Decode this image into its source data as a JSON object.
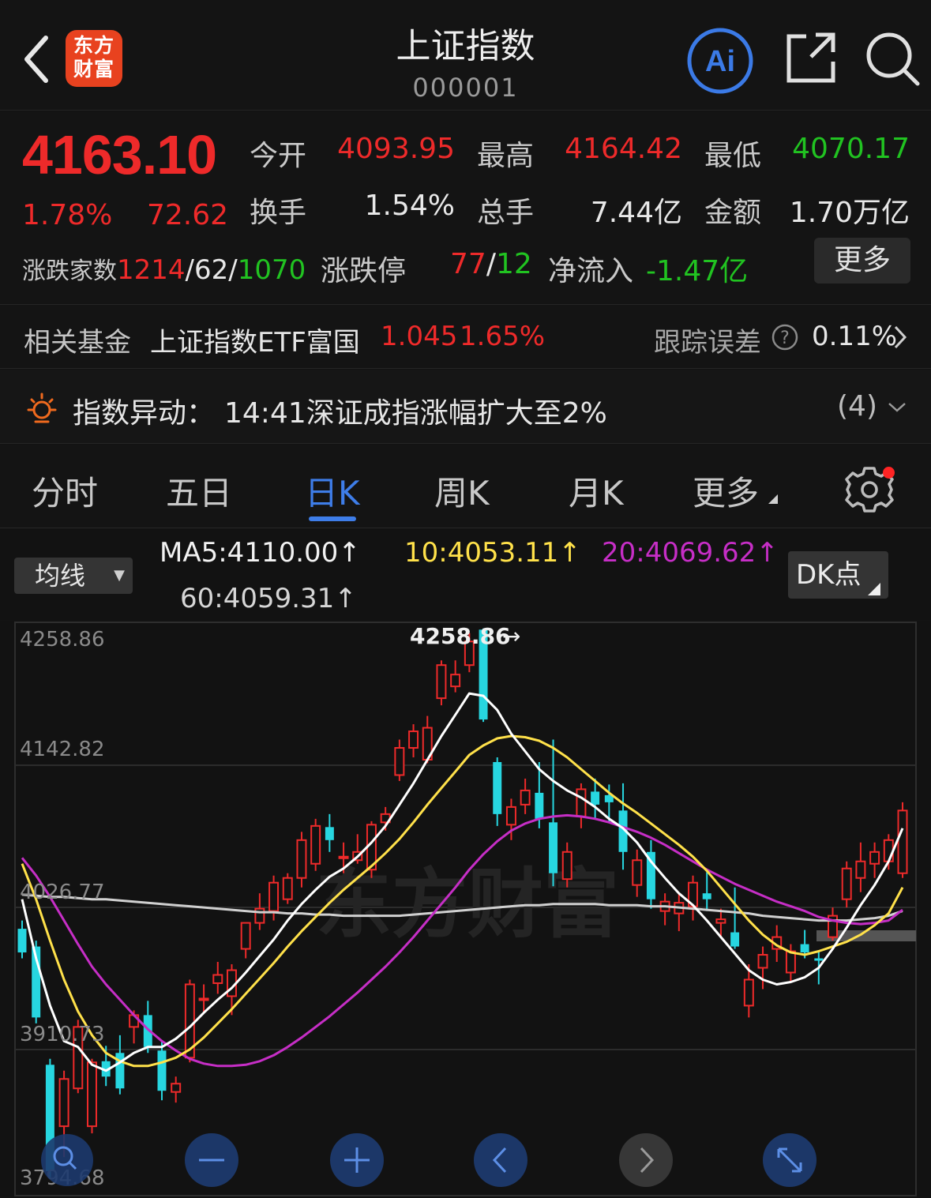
{
  "header": {
    "logo_text": "东方财富",
    "title": "上证指数",
    "code": "000001",
    "ai_label": "Ai",
    "icons": [
      "back-icon",
      "ai-icon",
      "share-icon",
      "search-icon"
    ]
  },
  "quote": {
    "price": "4163.10",
    "change_pct": "1.78%",
    "change": "72.62",
    "stats": [
      {
        "label": "今开",
        "value": "4093.95",
        "color": "red"
      },
      {
        "label": "最高",
        "value": "4164.42",
        "color": "red"
      },
      {
        "label": "最低",
        "value": "4070.17",
        "color": "green"
      },
      {
        "label": "换手",
        "value": "1.54%",
        "color": "white"
      },
      {
        "label": "总手",
        "value": "7.44亿",
        "color": "white"
      },
      {
        "label": "金额",
        "value": "1.70万亿",
        "color": "white"
      }
    ],
    "breadth_label": "涨跌家数",
    "breadth_up": "1214",
    "breadth_flat": "62",
    "breadth_down": "1070",
    "limit_label": "涨跌停",
    "limit_up": "77",
    "limit_down": "12",
    "netflow_label": "净流入",
    "netflow": "-1.47亿",
    "more_label": "更多",
    "slash": "/"
  },
  "fund": {
    "label": "相关基金",
    "name": "上证指数ETF富国",
    "price": "1.045",
    "pct": "1.65%",
    "error_label": "跟踪误差",
    "error_value": "0.11%"
  },
  "alert": {
    "label": "指数异动：",
    "text": "14:41深证成指涨幅扩大至2%",
    "count": "(4)"
  },
  "tabs": [
    "分时",
    "五日",
    "日K",
    "周K",
    "月K",
    "更多"
  ],
  "active_tab": 2,
  "ma": {
    "selector": "均线",
    "ma5": "MA5:4110.00↑",
    "ma10": "10:4053.11↑",
    "ma20": "20:4069.62↑",
    "ma60": "60:4059.31↑",
    "dk": "DK点",
    "colors": {
      "ma5": "#ffffff",
      "ma10": "#ffe14a",
      "ma20": "#c62ec6",
      "ma60": "#d0d0d0"
    }
  },
  "chart_data": {
    "type": "candlestick",
    "y_ticks": [
      "4258.86",
      "4142.82",
      "4026.77",
      "3910.73",
      "3794.68"
    ],
    "ylim": [
      3794.68,
      4258.86
    ],
    "max_annotation": "4258.86",
    "watermark": "东方财富",
    "colors": {
      "up": "#ee2a2a",
      "down": "#27d6e0",
      "grid": "#2c2c2c"
    },
    "candles": [
      {
        "o": 4005,
        "h": 4012,
        "l": 3980,
        "c": 3985
      },
      {
        "o": 3990,
        "h": 3995,
        "l": 3925,
        "c": 3930
      },
      {
        "o": 3890,
        "h": 3895,
        "l": 3795,
        "c": 3800
      },
      {
        "o": 3838,
        "h": 3885,
        "l": 3812,
        "c": 3878
      },
      {
        "o": 3870,
        "h": 3928,
        "l": 3866,
        "c": 3922
      },
      {
        "o": 3838,
        "h": 3895,
        "l": 3832,
        "c": 3892
      },
      {
        "o": 3893,
        "h": 3906,
        "l": 3872,
        "c": 3880
      },
      {
        "o": 3900,
        "h": 3915,
        "l": 3865,
        "c": 3870
      },
      {
        "o": 3922,
        "h": 3936,
        "l": 3908,
        "c": 3932
      },
      {
        "o": 3932,
        "h": 3944,
        "l": 3900,
        "c": 3905
      },
      {
        "o": 3902,
        "h": 3910,
        "l": 3860,
        "c": 3868
      },
      {
        "o": 3867,
        "h": 3880,
        "l": 3858,
        "c": 3874
      },
      {
        "o": 3896,
        "h": 3962,
        "l": 3892,
        "c": 3958
      },
      {
        "o": 3946,
        "h": 3958,
        "l": 3934,
        "c": 3946
      },
      {
        "o": 3959,
        "h": 3977,
        "l": 3950,
        "c": 3966
      },
      {
        "o": 3948,
        "h": 3975,
        "l": 3932,
        "c": 3970
      },
      {
        "o": 3988,
        "h": 4004,
        "l": 3980,
        "c": 4010
      },
      {
        "o": 4010,
        "h": 4035,
        "l": 4004,
        "c": 4022
      },
      {
        "o": 4020,
        "h": 4050,
        "l": 4012,
        "c": 4044
      },
      {
        "o": 4030,
        "h": 4052,
        "l": 4026,
        "c": 4048
      },
      {
        "o": 4048,
        "h": 4087,
        "l": 4040,
        "c": 4080
      },
      {
        "o": 4060,
        "h": 4098,
        "l": 4054,
        "c": 4092
      },
      {
        "o": 4091,
        "h": 4102,
        "l": 4070,
        "c": 4080
      },
      {
        "o": 4065,
        "h": 4078,
        "l": 4052,
        "c": 4066
      },
      {
        "o": 4063,
        "h": 4085,
        "l": 4060,
        "c": 4070
      },
      {
        "o": 4055,
        "h": 4096,
        "l": 4048,
        "c": 4093
      },
      {
        "o": 4095,
        "h": 4108,
        "l": 4088,
        "c": 4102
      },
      {
        "o": 4135,
        "h": 4165,
        "l": 4130,
        "c": 4158
      },
      {
        "o": 4158,
        "h": 4178,
        "l": 4150,
        "c": 4172
      },
      {
        "o": 4148,
        "h": 4185,
        "l": 4145,
        "c": 4175
      },
      {
        "o": 4200,
        "h": 4232,
        "l": 4194,
        "c": 4228
      },
      {
        "o": 4210,
        "h": 4232,
        "l": 4205,
        "c": 4220
      },
      {
        "o": 4228,
        "h": 4255,
        "l": 4222,
        "c": 4248
      },
      {
        "o": 4258,
        "h": 4259,
        "l": 4180,
        "c": 4182
      },
      {
        "o": 4146,
        "h": 4150,
        "l": 4092,
        "c": 4102
      },
      {
        "o": 4093,
        "h": 4115,
        "l": 4080,
        "c": 4108
      },
      {
        "o": 4110,
        "h": 4132,
        "l": 4102,
        "c": 4122
      },
      {
        "o": 4120,
        "h": 4146,
        "l": 4090,
        "c": 4098
      },
      {
        "o": 4095,
        "h": 4165,
        "l": 4041,
        "c": 4052
      },
      {
        "o": 4047,
        "h": 4078,
        "l": 4040,
        "c": 4070
      },
      {
        "o": 4100,
        "h": 4128,
        "l": 4090,
        "c": 4123
      },
      {
        "o": 4121,
        "h": 4132,
        "l": 4098,
        "c": 4110
      },
      {
        "o": 4118,
        "h": 4127,
        "l": 4095,
        "c": 4112
      },
      {
        "o": 4105,
        "h": 4128,
        "l": 4055,
        "c": 4070
      },
      {
        "o": 4042,
        "h": 4072,
        "l": 4032,
        "c": 4063
      },
      {
        "o": 4070,
        "h": 4080,
        "l": 4022,
        "c": 4030
      },
      {
        "o": 4020,
        "h": 4035,
        "l": 4008,
        "c": 4028
      },
      {
        "o": 4018,
        "h": 4035,
        "l": 4003,
        "c": 4027
      },
      {
        "o": 4024,
        "h": 4050,
        "l": 4012,
        "c": 4044
      },
      {
        "o": 4035,
        "h": 4053,
        "l": 4020,
        "c": 4030
      },
      {
        "o": 4010,
        "h": 4022,
        "l": 3998,
        "c": 4013
      },
      {
        "o": 4002,
        "h": 4040,
        "l": 3988,
        "c": 3990
      },
      {
        "o": 3940,
        "h": 3975,
        "l": 3930,
        "c": 3962
      },
      {
        "o": 3972,
        "h": 3990,
        "l": 3954,
        "c": 3983
      },
      {
        "o": 3988,
        "h": 4008,
        "l": 3977,
        "c": 3998
      },
      {
        "o": 3968,
        "h": 3992,
        "l": 3960,
        "c": 3986
      },
      {
        "o": 3992,
        "h": 4004,
        "l": 3980,
        "c": 3985
      },
      {
        "o": 3980,
        "h": 3986,
        "l": 3958,
        "c": 3978
      },
      {
        "o": 3998,
        "h": 4023,
        "l": 3995,
        "c": 4016
      },
      {
        "o": 4030,
        "h": 4062,
        "l": 4023,
        "c": 4056
      },
      {
        "o": 4048,
        "h": 4078,
        "l": 4036,
        "c": 4062
      },
      {
        "o": 4060,
        "h": 4078,
        "l": 4048,
        "c": 4070
      },
      {
        "o": 4062,
        "h": 4085,
        "l": 4055,
        "c": 4080
      },
      {
        "o": 4052,
        "h": 4112,
        "l": 4048,
        "c": 4105
      }
    ],
    "ma5": [
      4030,
      3980,
      3940,
      3910,
      3905,
      3890,
      3885,
      3892,
      3900,
      3905,
      3905,
      3912,
      3922,
      3934,
      3945,
      3955,
      3968,
      3982,
      3996,
      4012,
      4026,
      4038,
      4049,
      4056,
      4066,
      4078,
      4092,
      4110,
      4128,
      4148,
      4168,
      4186,
      4204,
      4202,
      4190,
      4170,
      4155,
      4140,
      4130,
      4122,
      4116,
      4108,
      4098,
      4090,
      4078,
      4062,
      4048,
      4035,
      4025,
      4012,
      3998,
      3984,
      3970,
      3962,
      3958,
      3960,
      3964,
      3972,
      3988,
      4006,
      4025,
      4042,
      4062,
      4090
    ],
    "ma10": [
      4060,
      4030,
      3995,
      3962,
      3935,
      3915,
      3900,
      3893,
      3889,
      3889,
      3892,
      3896,
      3903,
      3913,
      3925,
      3937,
      3950,
      3963,
      3976,
      3990,
      4003,
      4015,
      4027,
      4038,
      4048,
      4058,
      4069,
      4081,
      4095,
      4110,
      4124,
      4138,
      4152,
      4160,
      4166,
      4168,
      4167,
      4164,
      4158,
      4150,
      4140,
      4130,
      4120,
      4111,
      4103,
      4094,
      4085,
      4076,
      4066,
      4054,
      4040,
      4026,
      4012,
      4000,
      3991,
      3985,
      3983,
      3986,
      3990,
      3994,
      4000,
      4008,
      4018,
      4040
    ],
    "ma20": [
      4065,
      4050,
      4032,
      4012,
      3992,
      3973,
      3958,
      3945,
      3932,
      3920,
      3910,
      3902,
      3895,
      3891,
      3889,
      3889,
      3890,
      3893,
      3898,
      3905,
      3913,
      3922,
      3931,
      3941,
      3951,
      3962,
      3973,
      3985,
      3998,
      4012,
      4026,
      4040,
      4055,
      4068,
      4079,
      4088,
      4094,
      4098,
      4100,
      4101,
      4100,
      4098,
      4095,
      4091,
      4087,
      4082,
      4076,
      4069,
      4062,
      4055,
      4049,
      4043,
      4038,
      4033,
      4028,
      4024,
      4020,
      4015,
      4012,
      4010,
      4009,
      4010,
      4012,
      4021
    ],
    "ma60": [
      4034,
      4033,
      4032,
      4032,
      4031,
      4030,
      4030,
      4029,
      4028,
      4027,
      4026,
      4025,
      4024,
      4023,
      4022,
      4021,
      4020,
      4019,
      4019,
      4018,
      4018,
      4017,
      4017,
      4016,
      4016,
      4016,
      4016,
      4016,
      4017,
      4018,
      4019,
      4020,
      4021,
      4022,
      4023,
      4024,
      4025,
      4025,
      4026,
      4026,
      4026,
      4026,
      4025,
      4025,
      4025,
      4024,
      4024,
      4023,
      4022,
      4021,
      4020,
      4019,
      4018,
      4016,
      4015,
      4014,
      4013,
      4012,
      4012,
      4012,
      4013,
      4014,
      4016,
      4020
    ]
  },
  "chart_controls": [
    "search-icon",
    "zoom-out-icon",
    "zoom-in-icon",
    "scroll-left-icon",
    "scroll-right-icon",
    "expand-icon"
  ]
}
